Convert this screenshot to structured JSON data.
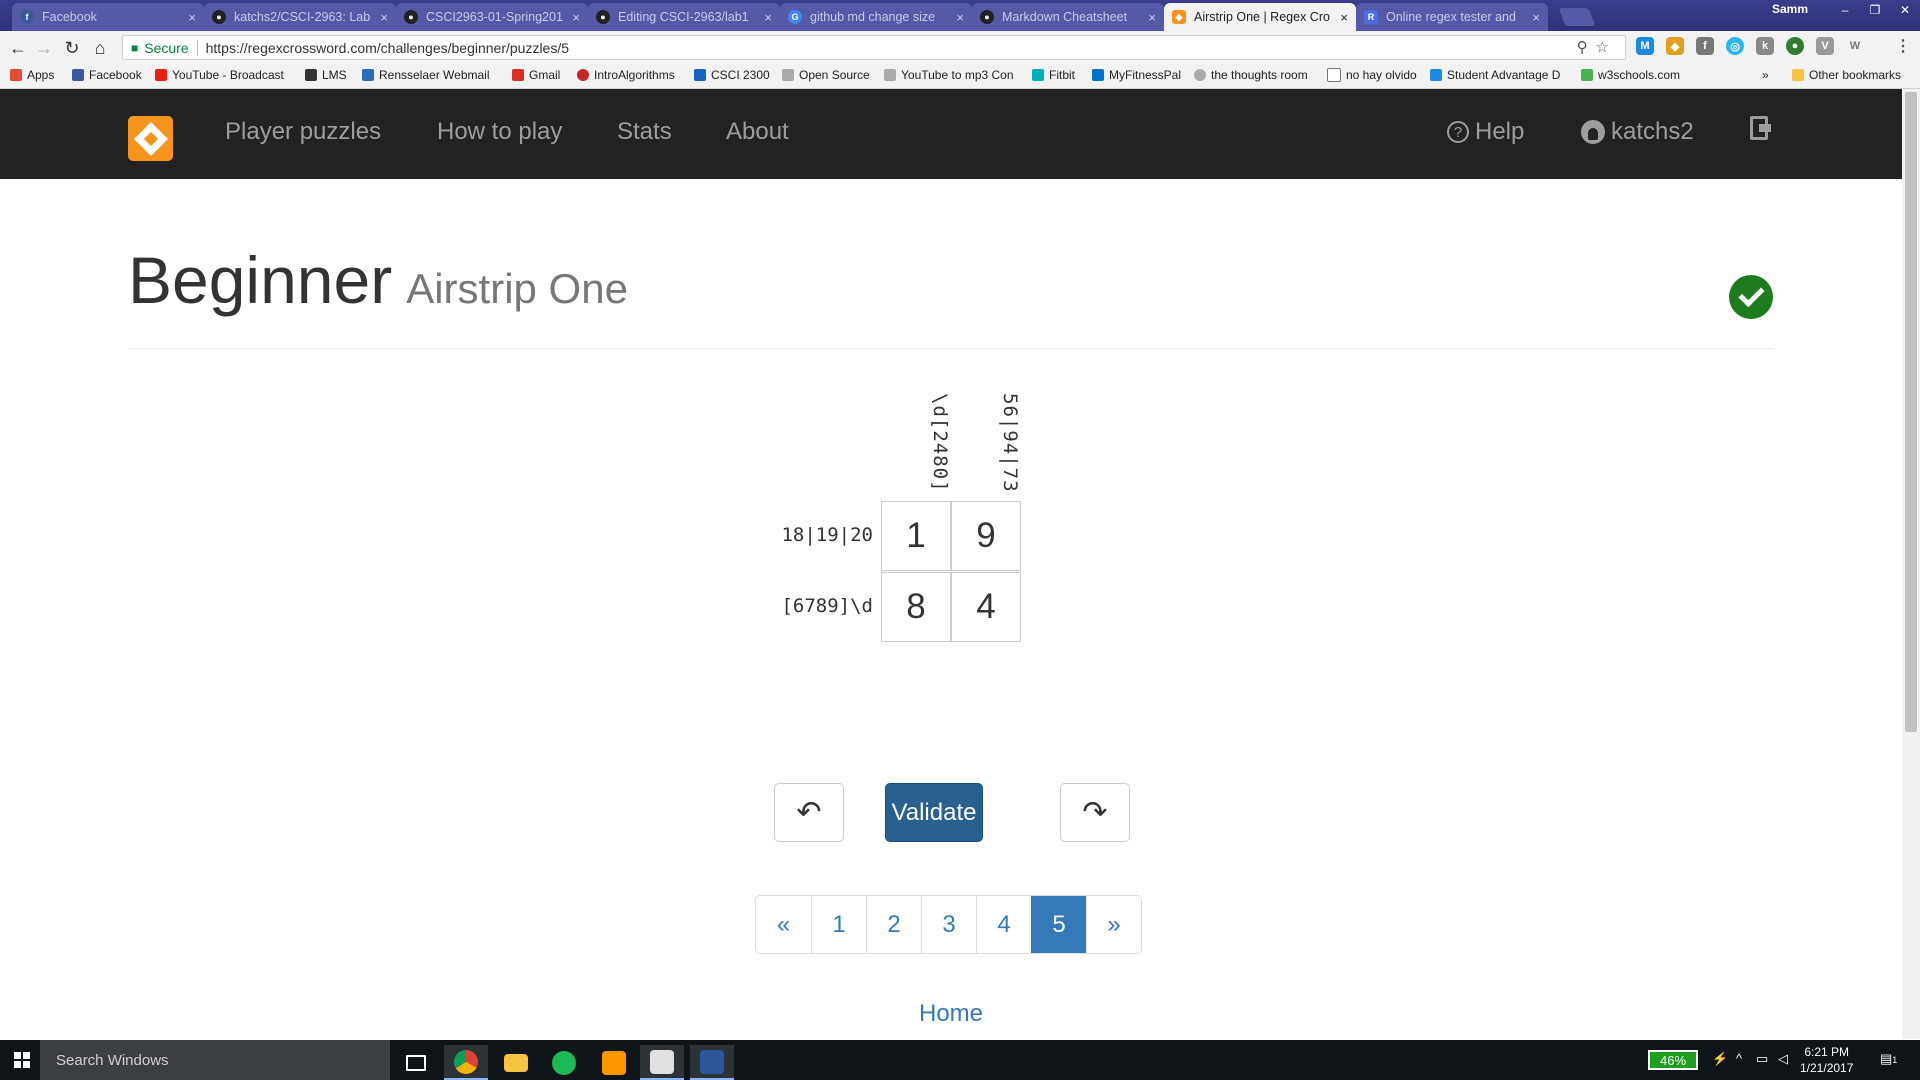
{
  "browser": {
    "tabs": [
      {
        "title": "Facebook",
        "icon": "facebook-icon",
        "color": "#3b5998",
        "glyph": "f"
      },
      {
        "title": "katchs2/CSCI-2963: Lab",
        "icon": "github-icon",
        "color": "#222222",
        "glyph": ""
      },
      {
        "title": "CSCI2963-01-Spring201",
        "icon": "github-icon",
        "color": "#222222",
        "glyph": ""
      },
      {
        "title": "Editing CSCI-2963/lab1",
        "icon": "github-icon",
        "color": "#222222",
        "glyph": ""
      },
      {
        "title": "github md change size",
        "icon": "google-icon",
        "color": "#4285f4",
        "glyph": "G"
      },
      {
        "title": "Markdown Cheatsheet",
        "icon": "github-icon",
        "color": "#222222",
        "glyph": ""
      },
      {
        "title": "Airstrip One | Regex Cro",
        "icon": "regexcrossword-icon",
        "color": "#f7941d",
        "glyph": ""
      },
      {
        "title": "Online regex tester and",
        "icon": "regex101-icon",
        "color": "#4a6ee0",
        "glyph": "R"
      }
    ],
    "active_tab": 6,
    "profile_name": "Samm",
    "secure_label": "Secure",
    "url": "https://regexcrossword.com/challenges/beginner/puzzles/5"
  },
  "bookmarks": [
    {
      "label": "Apps",
      "color": "#e34b3b"
    },
    {
      "label": "Facebook",
      "color": "#3b5998"
    },
    {
      "label": "YouTube - Broadcast",
      "color": "#e62117"
    },
    {
      "label": "LMS",
      "color": "#333333"
    },
    {
      "label": "Rensselaer Webmail",
      "color": "#2a6ebb"
    },
    {
      "label": "Gmail",
      "color": "#d93025"
    },
    {
      "label": "IntroAlgorithms",
      "color": "#c62828"
    },
    {
      "label": "CSCI 2300",
      "color": "#1565c0"
    },
    {
      "label": "Open Source",
      "color": "#888888"
    },
    {
      "label": "YouTube to mp3 Con",
      "color": "#888888"
    },
    {
      "label": "Fitbit",
      "color": "#00b0b9"
    },
    {
      "label": "MyFitnessPal",
      "color": "#0073cf"
    },
    {
      "label": "the thoughts room",
      "color": "#666666"
    },
    {
      "label": "no hay olvido",
      "color": "#666666"
    },
    {
      "label": "Student Advantage D",
      "color": "#1e88e5"
    },
    {
      "label": "w3schools.com",
      "color": "#4caf50"
    }
  ],
  "other_bookmarks": "Other bookmarks",
  "nav": {
    "links": [
      "Player puzzles",
      "How to play",
      "Stats",
      "About"
    ],
    "help": "Help",
    "user": "katchs2"
  },
  "puzzle": {
    "level": "Beginner",
    "name": "Airstrip One",
    "solved": true,
    "column_clues": [
      "\\d[2480]",
      "56|94|73"
    ],
    "row_clues": [
      "18|19|20",
      "[6789]\\d"
    ],
    "cells": [
      [
        "1",
        "9"
      ],
      [
        "8",
        "4"
      ]
    ],
    "validate_label": "Validate",
    "undo_symbol": "↶",
    "redo_symbol": "↷"
  },
  "pagination": {
    "prev": "«",
    "pages": [
      "1",
      "2",
      "3",
      "4",
      "5"
    ],
    "current": "5",
    "next": "»"
  },
  "home_link": "Home",
  "taskbar": {
    "search_placeholder": "Search Windows",
    "battery": "46%",
    "time": "6:21 PM",
    "date": "1/21/2017",
    "notification_count": "1"
  },
  "colors": {
    "navbar_bg": "#222222",
    "logo_orange": "#f7941d",
    "primary_button": "#286090",
    "link_blue": "#337ab7",
    "solved_green": "#1e7c1e"
  }
}
